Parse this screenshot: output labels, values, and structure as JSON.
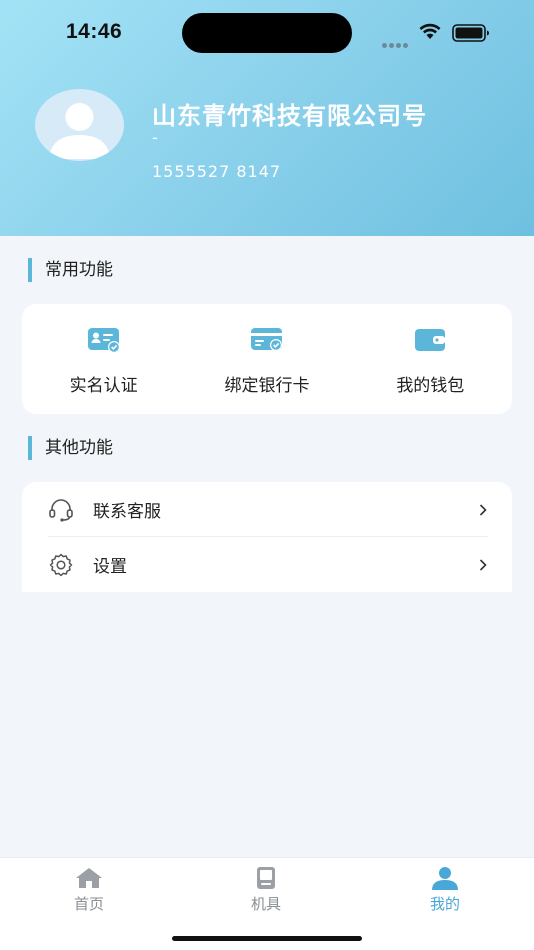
{
  "status_bar": {
    "time": "14:46"
  },
  "profile": {
    "company_name": "山东青竹科技有限公司号",
    "company_name_cont": "-",
    "phone": "1555527 8147"
  },
  "sections": {
    "common": {
      "title": "常用功能",
      "items": [
        {
          "label": "实名认证",
          "icon": "id-card-check-icon"
        },
        {
          "label": "绑定银行卡",
          "icon": "bank-card-check-icon"
        },
        {
          "label": "我的钱包",
          "icon": "wallet-icon"
        }
      ]
    },
    "other": {
      "title": "其他功能",
      "items": [
        {
          "label": "联系客服",
          "icon": "headset-icon"
        },
        {
          "label": "设置",
          "icon": "gear-icon"
        }
      ]
    }
  },
  "tabbar": {
    "tabs": [
      {
        "label": "首页",
        "icon": "home-icon"
      },
      {
        "label": "机具",
        "icon": "device-icon"
      },
      {
        "label": "我的",
        "icon": "user-icon"
      }
    ],
    "active_color": "#4aa8d8",
    "inactive_color": "#8a8f94"
  },
  "colors": {
    "accent": "#5bb6d9",
    "header_gradient_start": "#a3e3f6",
    "header_gradient_end": "#6ec0e0"
  }
}
